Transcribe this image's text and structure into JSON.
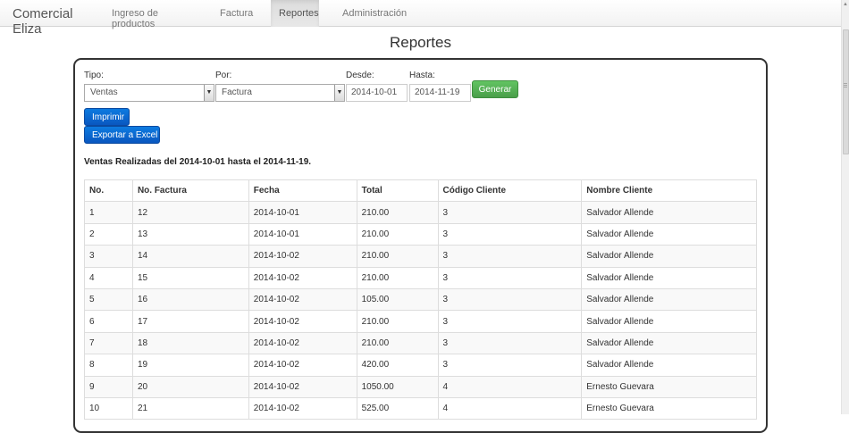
{
  "nav": {
    "brand": "Comercial Eliza",
    "items": [
      {
        "label": "Ingreso de productos"
      },
      {
        "label": "Factura"
      },
      {
        "label": "Reportes"
      },
      {
        "label": "Administración"
      }
    ],
    "active_index": 2
  },
  "page": {
    "title": "Reportes"
  },
  "form": {
    "tipo_label": "Tipo:",
    "tipo_value": "Ventas",
    "por_label": "Por:",
    "por_value": "Factura",
    "desde_label": "Desde:",
    "desde_value": "2014-10-01",
    "hasta_label": "Hasta:",
    "hasta_value": "2014-11-19",
    "generar_label": "Generar",
    "imprimir_label": "Imprimir",
    "exportar_label": "Exportar a Excel"
  },
  "summary": "Ventas Realizadas del 2014-10-01 hasta el 2014-11-19.",
  "table": {
    "headers": [
      "No.",
      "No. Factura",
      "Fecha",
      "Total",
      "Código Cliente",
      "Nombre Cliente"
    ],
    "rows": [
      [
        "1",
        "12",
        "2014-10-01",
        "210.00",
        "3",
        "Salvador Allende"
      ],
      [
        "2",
        "13",
        "2014-10-01",
        "210.00",
        "3",
        "Salvador Allende"
      ],
      [
        "3",
        "14",
        "2014-10-02",
        "210.00",
        "3",
        "Salvador Allende"
      ],
      [
        "4",
        "15",
        "2014-10-02",
        "210.00",
        "3",
        "Salvador Allende"
      ],
      [
        "5",
        "16",
        "2014-10-02",
        "105.00",
        "3",
        "Salvador Allende"
      ],
      [
        "6",
        "17",
        "2014-10-02",
        "210.00",
        "3",
        "Salvador Allende"
      ],
      [
        "7",
        "18",
        "2014-10-02",
        "210.00",
        "3",
        "Salvador Allende"
      ],
      [
        "8",
        "19",
        "2014-10-02",
        "420.00",
        "3",
        "Salvador Allende"
      ],
      [
        "9",
        "20",
        "2014-10-02",
        "1050.00",
        "4",
        "Ernesto Guevara"
      ],
      [
        "10",
        "21",
        "2014-10-02",
        "525.00",
        "4",
        "Ernesto Guevara"
      ]
    ]
  },
  "icons": {
    "select_arrow": "chevron-down-icon",
    "scroll_up": "arrow-up-icon"
  },
  "colors": {
    "primary": "#0a67d0",
    "success": "#51a351",
    "panel_border": "#333333"
  }
}
